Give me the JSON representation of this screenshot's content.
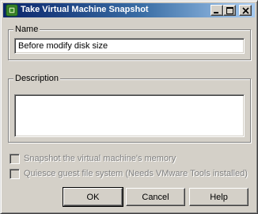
{
  "window": {
    "title": "Take Virtual Machine Snapshot",
    "title_icon": "vmware-snapshot-icon",
    "titlebar_colors": {
      "start": "#0a246a",
      "end": "#a6caf0"
    }
  },
  "name_group": {
    "legend": "Name",
    "value": "Before modify disk size"
  },
  "description_group": {
    "legend": "Description",
    "value": ""
  },
  "options": {
    "memory": {
      "label": "Snapshot the virtual machine's memory",
      "checked": false,
      "enabled": false
    },
    "quiesce": {
      "label": "Quiesce guest file system (Needs VMware Tools installed)",
      "checked": false,
      "enabled": false
    }
  },
  "buttons": {
    "ok": "OK",
    "cancel": "Cancel",
    "help": "Help"
  }
}
